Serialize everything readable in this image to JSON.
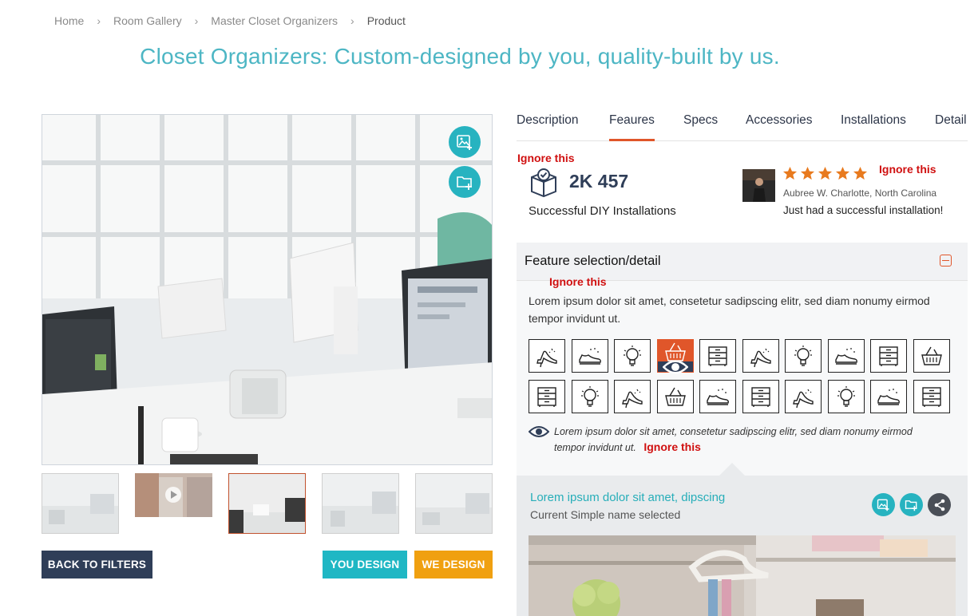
{
  "breadcrumb": {
    "home": "Home",
    "room_gallery": "Room Gallery",
    "master_closet": "Master Closet Organizers",
    "product": "Product",
    "separator": "›"
  },
  "page_title": "Closet Organizers: Custom-designed by you, quality-built by us.",
  "gallery": {
    "add_image_icon": "image-plus-icon",
    "add_folder_icon": "folder-plus-icon",
    "active_thumbnail": 3
  },
  "buttons": {
    "back": "BACK TO FILTERS",
    "you_design": "YOU DESIGN",
    "we_design": "WE DESIGN"
  },
  "tabs": [
    {
      "label": "Description"
    },
    {
      "label": "Feaures"
    },
    {
      "label": "Specs"
    },
    {
      "label": "Accessories"
    },
    {
      "label": "Installations"
    },
    {
      "label": "Detail"
    }
  ],
  "notes": {
    "n1": "Ignore this",
    "n2": "Ignore this",
    "n3": "Ignore this",
    "n4": "Ignore this"
  },
  "stats": {
    "number": "2K 457",
    "label": "Successful DIY Installations"
  },
  "review": {
    "rating": 5,
    "reviewer": "Aubree W. Charlotte, North Carolina",
    "text": "Just had a successful installation!"
  },
  "feature": {
    "title": "Feature selection/detail",
    "description": "Lorem ipsum dolor sit amet, consetetur sadipscing elitr, sed diam nonumy eirmod tempor invidunt ut.",
    "legend": "Lorem ipsum dolor sit amet, consetetur sadipscing elitr, sed diam nonumy eirmod tempor invidunt ut.",
    "row1": [
      "heel-shoe-icon",
      "sneaker-icon",
      "lightbulb-icon",
      "basket-icon",
      "drawer-icon",
      "heel-shoe-icon",
      "lightbulb-icon",
      "sneaker-icon",
      "drawer-icon",
      "basket-icon"
    ],
    "row2": [
      "drawer-icon",
      "lightbulb-icon",
      "heel-shoe-icon",
      "basket-icon",
      "sneaker-icon",
      "drawer-icon",
      "heel-shoe-icon",
      "lightbulb-icon",
      "sneaker-icon",
      "drawer-icon"
    ],
    "selected_index": 3
  },
  "selection": {
    "title": "Lorem ipsum dolor sit amet, dipscing",
    "subtitle": "Current Simple name selected"
  },
  "colors": {
    "teal": "#27b3c0",
    "orange": "#e0562a",
    "navy": "#2f3e58",
    "gold": "#f0a010",
    "note_red": "#d01010"
  }
}
